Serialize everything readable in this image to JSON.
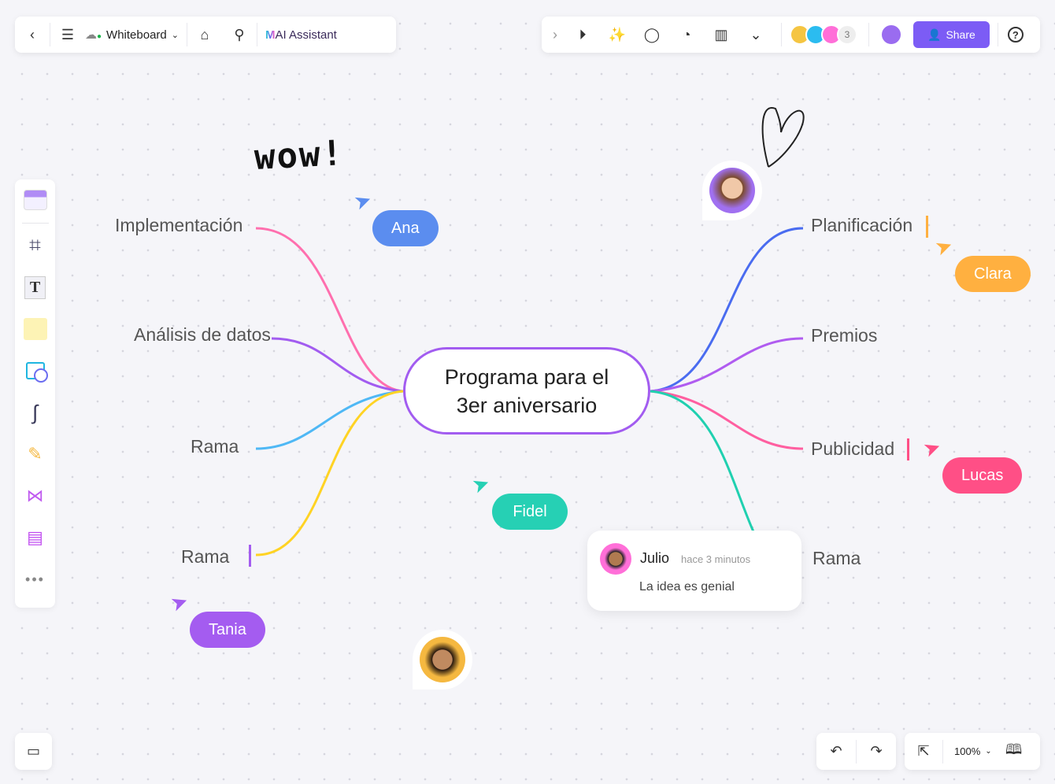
{
  "toolbar_left": {
    "back": "chevron-left-icon",
    "menu": "menu-icon",
    "board_name": "Whiteboard",
    "tag": "tag-icon",
    "search": "search-icon",
    "ai_label": "AI Assistant"
  },
  "toolbar_right": {
    "participant_count": "3",
    "share_label": "Share",
    "help": "?"
  },
  "mindmap": {
    "center": [
      "Programa para el",
      "3er aniversario"
    ],
    "left": [
      "Implementación",
      "Análisis de datos",
      "Rama",
      "Rama"
    ],
    "right": [
      "Planificación",
      "Premios",
      "Publicidad",
      "Rama"
    ]
  },
  "cursors": [
    {
      "name": "Ana",
      "color": "#5b8def"
    },
    {
      "name": "Clara",
      "color": "#ffb040"
    },
    {
      "name": "Lucas",
      "color": "#ff4f86"
    },
    {
      "name": "Fidel",
      "color": "#26d0b4"
    },
    {
      "name": "Tania",
      "color": "#a45cf0"
    }
  ],
  "handwriting": "wow!",
  "comment": {
    "author": "Julio",
    "time": "hace 3 minutos",
    "text": "La idea es genial"
  },
  "zoom": "100%",
  "colors": {
    "accent": "#7c5cf5",
    "pink": "#ff6fae",
    "purple": "#a25cf0",
    "blue": "#4fb8f5",
    "yellow": "#ffd324",
    "darkblue": "#4a6cf0",
    "teal": "#20d0b0"
  }
}
